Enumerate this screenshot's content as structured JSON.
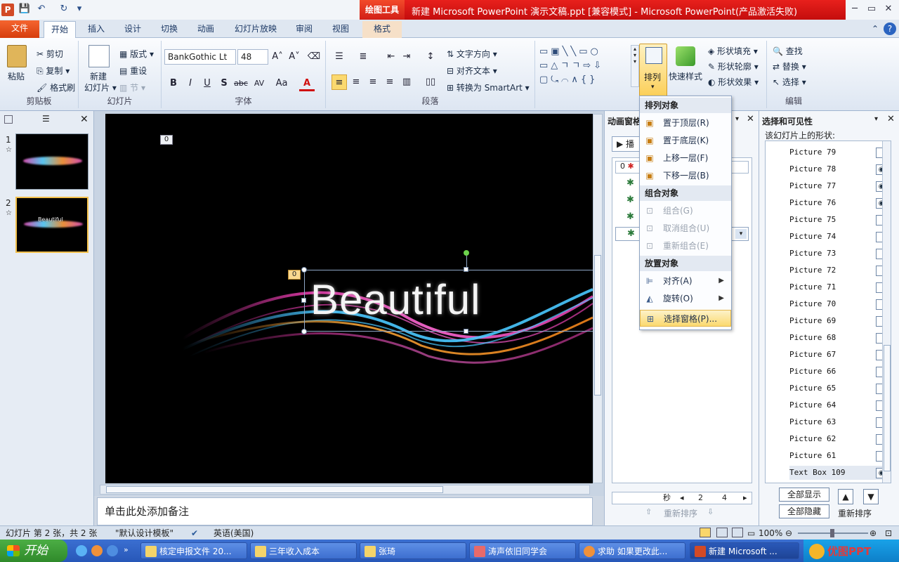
{
  "titlebar": {
    "context_tool": "绘图工具",
    "title": "新建 Microsoft PowerPoint 演示文稿.ppt [兼容模式] - Microsoft PowerPoint(产品激活失败)",
    "min": "─",
    "restore": "▭",
    "close": "✕",
    "app_icon": "P",
    "qa_save": "💾",
    "qa_undo": "↶",
    "qa_redo": "↻",
    "qa_more": "▾"
  },
  "tabs": {
    "file": "文件",
    "home": "开始",
    "insert": "插入",
    "design": "设计",
    "transitions": "切换",
    "animations": "动画",
    "slideshow": "幻灯片放映",
    "review": "审阅",
    "view": "视图",
    "format": "格式",
    "help": "?",
    "collapse": "⌃"
  },
  "ribbon": {
    "clipboard": {
      "label": "剪贴板",
      "paste": "粘贴",
      "cut": "剪切",
      "copy": "复制",
      "painter": "格式刷"
    },
    "slides": {
      "label": "幻灯片",
      "new": "新建",
      "new2": "幻灯片",
      "layout": "版式",
      "reset": "重设",
      "section": "节"
    },
    "font": {
      "label": "字体",
      "name": "BankGothic Lt",
      "size": "48",
      "bold": "B",
      "italic": "I",
      "underline": "U",
      "shadow": "S",
      "strike": "abc",
      "spacing": "AV",
      "case": "Aa",
      "color": "A"
    },
    "paragraph": {
      "label": "段落",
      "direction": "文字方向",
      "align_text": "对齐文本",
      "smartart": "转换为 SmartArt"
    },
    "drawing": {
      "arrange": "排列",
      "quickstyle": "快速样式",
      "fill": "形状填充",
      "outline": "形状轮廓",
      "effects": "形状效果"
    },
    "editing": {
      "label": "编辑",
      "find": "查找",
      "replace": "替换",
      "select": "选择"
    }
  },
  "leftpane": {
    "close": "✕",
    "slide1_num": "1",
    "slide2_num": "2",
    "slide2_caption": "Beautiful"
  },
  "slide": {
    "text": "Beautiful",
    "tag_top": "0",
    "tag_text": "0"
  },
  "notes": {
    "placeholder": "单击此处添加备注"
  },
  "animpane": {
    "title": "动画窗格",
    "play": "播",
    "item0": "0",
    "seconds": "秒",
    "v1": "2",
    "v2": "4",
    "reorder": "重新排序"
  },
  "menu": {
    "h1": "排列对象",
    "front": "置于顶层(R)",
    "back": "置于底层(K)",
    "forward": "上移一层(F)",
    "backward": "下移一层(B)",
    "h2": "组合对象",
    "group": "组合(G)",
    "ungroup": "取消组合(U)",
    "regroup": "重新组合(E)",
    "h3": "放置对象",
    "align": "对齐(A)",
    "rotate": "旋转(O)",
    "selpane": "选择窗格(P)..."
  },
  "selpane": {
    "title": "选择和可见性",
    "subtitle": "该幻灯片上的形状:",
    "show_all": "全部显示",
    "hide_all": "全部隐藏",
    "reorder": "重新排序",
    "items": [
      {
        "name": "Picture 79",
        "vis": ""
      },
      {
        "name": "Picture 78",
        "vis": "◉"
      },
      {
        "name": "Picture 77",
        "vis": "◉"
      },
      {
        "name": "Picture 76",
        "vis": "◉"
      },
      {
        "name": "Picture 75",
        "vis": ""
      },
      {
        "name": "Picture 74",
        "vis": ""
      },
      {
        "name": "Picture 73",
        "vis": ""
      },
      {
        "name": "Picture 72",
        "vis": ""
      },
      {
        "name": "Picture 71",
        "vis": ""
      },
      {
        "name": "Picture 70",
        "vis": ""
      },
      {
        "name": "Picture 69",
        "vis": ""
      },
      {
        "name": "Picture 68",
        "vis": ""
      },
      {
        "name": "Picture 67",
        "vis": ""
      },
      {
        "name": "Picture 66",
        "vis": ""
      },
      {
        "name": "Picture 65",
        "vis": ""
      },
      {
        "name": "Picture 64",
        "vis": ""
      },
      {
        "name": "Picture 63",
        "vis": ""
      },
      {
        "name": "Picture 62",
        "vis": ""
      },
      {
        "name": "Picture 61",
        "vis": ""
      },
      {
        "name": "Text Box 109",
        "vis": "◉"
      }
    ]
  },
  "status": {
    "slide": "幻灯片 第 2 张，共 2 张",
    "template": "\"默认设计模板\"",
    "lang": "英语(美国)",
    "zoom": "100%"
  },
  "taskbar": {
    "start": "开始",
    "t1": "核定申报文件 20...",
    "t2": "三年收入成本",
    "t3": "张琦",
    "t4": "涛声依旧同学会",
    "t5": "求助 如果更改此...",
    "t6": "新建 Microsoft ...",
    "logo": "优图PPT"
  }
}
